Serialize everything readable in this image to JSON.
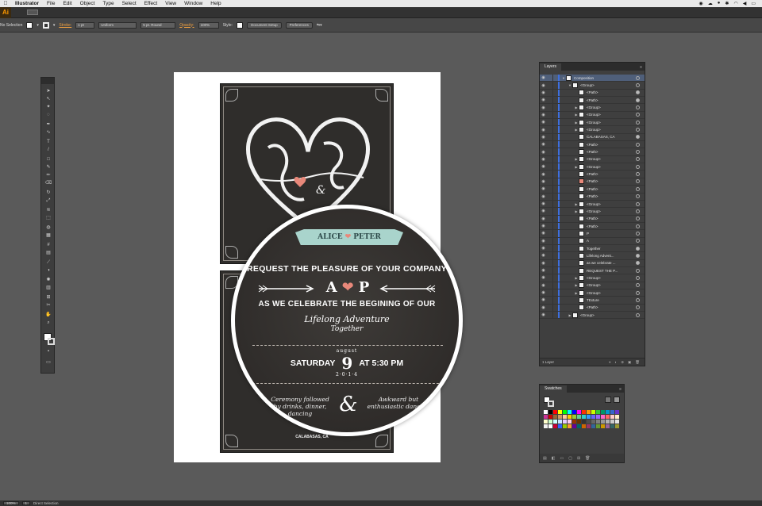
{
  "menubar": {
    "apple": "",
    "app_name": "Illustrator",
    "items": [
      "File",
      "Edit",
      "Object",
      "Type",
      "Select",
      "Effect",
      "View",
      "Window",
      "Help"
    ]
  },
  "appbar": {
    "logo": "Ai"
  },
  "controlbar": {
    "selection_label": "No Selection",
    "stroke_label": "Stroke:",
    "stroke_weight": "1 pt",
    "stroke_profile": "Uniform",
    "brush": "5 pt. Round",
    "opacity_label": "Opacity:",
    "opacity_value": "100%",
    "style_label": "Style:",
    "document_setup": "Document Setup",
    "preferences": "Preferences"
  },
  "invite": {
    "ribbon": "ALICE ❤ PETER",
    "ribbon_left": "ALICE",
    "ribbon_right": "PETER",
    "line1": "REQUEST THE PLEASURE OF YOUR COMPANY",
    "initial_a": "A",
    "initial_p": "P",
    "line2": "AS WE CELEBRATE THE BEGINING OF OUR",
    "script1": "Lifelong Adventure",
    "script2": "Together",
    "month": "august",
    "day_left": "SATURDAY",
    "day_num": "9",
    "time": "AT 5:30 PM",
    "year": "2·0·1·4",
    "left_note": "Ceremony followed by drinks, dinner, dancing",
    "right_note": "Awkward but enthusiastic dancing",
    "ampersand": "&",
    "location": "CALABASAS, CA"
  },
  "layers_panel": {
    "tab": "Layers",
    "footer": "1 Layer",
    "rows": [
      {
        "name": "Composition",
        "indent": 0,
        "tri": "▼",
        "thumb": "white",
        "selected": true
      },
      {
        "name": "<Group>",
        "indent": 1,
        "tri": "▼",
        "thumb": "white"
      },
      {
        "name": "<Path>",
        "indent": 2,
        "tri": "",
        "thumb": "white",
        "target": true
      },
      {
        "name": "<Path>",
        "indent": 2,
        "tri": "",
        "thumb": "white",
        "target": true
      },
      {
        "name": "<Group>",
        "indent": 2,
        "tri": "▶",
        "thumb": "white"
      },
      {
        "name": "<Group>",
        "indent": 2,
        "tri": "▶",
        "thumb": "white"
      },
      {
        "name": "<Group>",
        "indent": 2,
        "tri": "▶",
        "thumb": "white"
      },
      {
        "name": "<Group>",
        "indent": 2,
        "tri": "▶",
        "thumb": "white"
      },
      {
        "name": "CALABASAS, CA",
        "indent": 2,
        "tri": "",
        "thumb": "white",
        "target": true
      },
      {
        "name": "<Path>",
        "indent": 2,
        "tri": "",
        "thumb": "white"
      },
      {
        "name": "<Path>",
        "indent": 2,
        "tri": "",
        "thumb": "white"
      },
      {
        "name": "<Group>",
        "indent": 2,
        "tri": "▶",
        "thumb": "white"
      },
      {
        "name": "<Group>",
        "indent": 2,
        "tri": "▶",
        "thumb": "white"
      },
      {
        "name": "<Path>",
        "indent": 2,
        "tri": "",
        "thumb": "white"
      },
      {
        "name": "<Path>",
        "indent": 2,
        "tri": "",
        "thumb": "pink"
      },
      {
        "name": "<Path>",
        "indent": 2,
        "tri": "",
        "thumb": "white"
      },
      {
        "name": "<Path>",
        "indent": 2,
        "tri": "",
        "thumb": "white"
      },
      {
        "name": "<Group>",
        "indent": 2,
        "tri": "▶",
        "thumb": "white"
      },
      {
        "name": "<Group>",
        "indent": 2,
        "tri": "▶",
        "thumb": "white"
      },
      {
        "name": "<Path>",
        "indent": 2,
        "tri": "",
        "thumb": "white"
      },
      {
        "name": "<Path>",
        "indent": 2,
        "tri": "",
        "thumb": "white"
      },
      {
        "name": "P",
        "indent": 2,
        "tri": "",
        "thumb": "white"
      },
      {
        "name": "A",
        "indent": 2,
        "tri": "",
        "thumb": "white"
      },
      {
        "name": "Together",
        "indent": 2,
        "tri": "",
        "thumb": "white",
        "target": true
      },
      {
        "name": "Lifelong Advent...",
        "indent": 2,
        "tri": "",
        "thumb": "white",
        "target": true
      },
      {
        "name": "as we celebrate ...",
        "indent": 2,
        "tri": "",
        "thumb": "white",
        "target": true
      },
      {
        "name": "REQUEST THE P...",
        "indent": 2,
        "tri": "",
        "thumb": "white"
      },
      {
        "name": "<Group>",
        "indent": 2,
        "tri": "▶",
        "thumb": "white"
      },
      {
        "name": "<Group>",
        "indent": 2,
        "tri": "▶",
        "thumb": "white"
      },
      {
        "name": "<Group>",
        "indent": 2,
        "tri": "▶",
        "thumb": "white"
      },
      {
        "name": "TExture",
        "indent": 2,
        "tri": "",
        "thumb": "white"
      },
      {
        "name": "<Path>",
        "indent": 2,
        "tri": "",
        "thumb": "white"
      },
      {
        "name": "<Group>",
        "indent": 1,
        "tri": "▶",
        "thumb": "white"
      }
    ]
  },
  "swatches_panel": {
    "tab": "Swatches",
    "colors": [
      "#ffffff",
      "#000000",
      "#ff0000",
      "#ffff00",
      "#00ff00",
      "#00ffff",
      "#0000ff",
      "#ff00ff",
      "#ff3300",
      "#ff9900",
      "#ccff00",
      "#33cc33",
      "#009966",
      "#0099cc",
      "#3366cc",
      "#6633cc",
      "#cc3399",
      "#cc0000",
      "#996633",
      "#cc9966",
      "#ffcc99",
      "#ffcc00",
      "#99cc33",
      "#66cc99",
      "#33cccc",
      "#3399ff",
      "#6666ff",
      "#9966ff",
      "#ff66cc",
      "#ff6666",
      "#ffcccc",
      "#ffeecc",
      "#ffffcc",
      "#ccffcc",
      "#ccffff",
      "#cce5ff",
      "#e5ccff",
      "#ffccee",
      "#993300",
      "#663300",
      "#333333",
      "#4d4d4d",
      "#666666",
      "#808080",
      "#999999",
      "#b3b3b3",
      "#cccccc",
      "#e6e6e6",
      "#f2f2f2",
      "#ffffff",
      "#cc0033",
      "#3366ff",
      "#99cc00",
      "#ff9933",
      "#660099",
      "#006666",
      "#cc6600",
      "#993366",
      "#336699",
      "#669933",
      "#cc9900",
      "#996699",
      "#336666",
      "#999933"
    ]
  },
  "statusbar": {
    "zoom": "100%",
    "page": "1",
    "tool": "Direct Selection"
  }
}
